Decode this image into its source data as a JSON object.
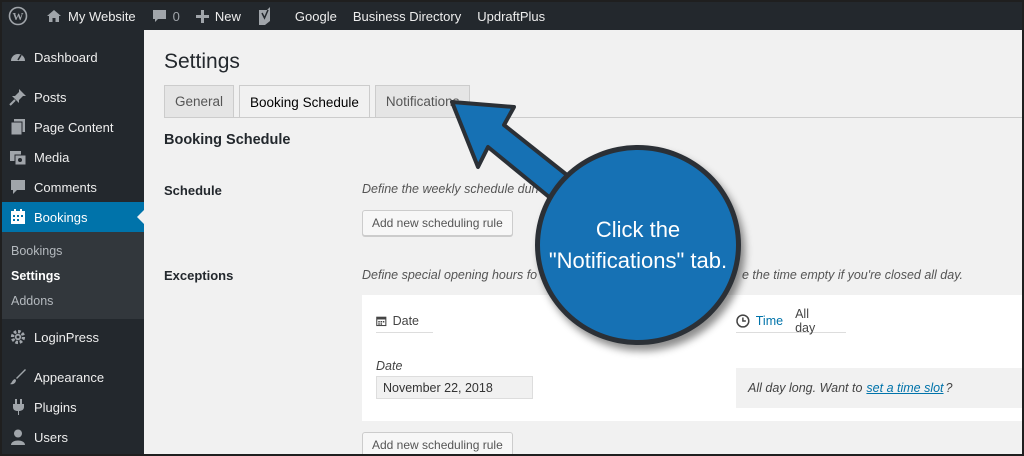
{
  "admin_bar": {
    "site_name": "My Website",
    "comments_count": "0",
    "new_label": "New",
    "links": [
      "Google",
      "Business Directory",
      "UpdraftPlus"
    ]
  },
  "sidebar": {
    "items": [
      {
        "label": "Dashboard",
        "icon": "dashboard-icon"
      },
      {
        "label": "Posts",
        "icon": "pin-icon"
      },
      {
        "label": "Page Content",
        "icon": "pages-icon"
      },
      {
        "label": "Media",
        "icon": "media-icon"
      },
      {
        "label": "Comments",
        "icon": "comment-icon"
      },
      {
        "label": "Bookings",
        "icon": "calendar-icon"
      }
    ],
    "submenu": [
      "Bookings",
      "Settings",
      "Addons"
    ],
    "items_after": [
      {
        "label": "LoginPress",
        "icon": "gear-icon"
      },
      {
        "label": "Appearance",
        "icon": "brush-icon"
      },
      {
        "label": "Plugins",
        "icon": "plug-icon"
      },
      {
        "label": "Users",
        "icon": "user-icon"
      }
    ]
  },
  "page": {
    "title": "Settings",
    "tabs": [
      "General",
      "Booking Schedule",
      "Notifications"
    ],
    "active_tab": "Booking Schedule",
    "section_title": "Booking Schedule",
    "schedule": {
      "label": "Schedule",
      "description": "Define the weekly schedule duri",
      "button": "Add new scheduling rule"
    },
    "exceptions": {
      "label": "Exceptions",
      "description_left": "Define special opening hours fo",
      "description_right": "e the time empty if you're closed all day.",
      "date_header": "Date",
      "time_header": "Time",
      "time_value": "All day",
      "date_field_label": "Date",
      "date_value": "November 22, 2018",
      "all_day_text": "All day long. Want to",
      "time_slot_link": "set a time slot",
      "all_day_suffix": "?",
      "button": "Add new scheduling rule"
    }
  },
  "callout": {
    "line1": "Click the",
    "line2": "\"Notifications\" tab."
  },
  "colors": {
    "accent": "#0073aa",
    "callout": "#1671b4",
    "adminbar": "#23282d"
  }
}
